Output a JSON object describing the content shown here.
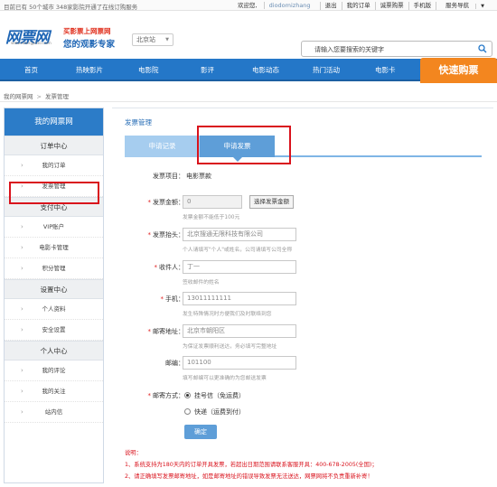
{
  "topbar": {
    "notice": "目前已有 50个城市 348家影院开通了在线订购服务",
    "greeting": "欢迎您,",
    "username": "diodomizhang",
    "logout": "退出",
    "my_orders": "我的订单",
    "tickets": "诚票购票",
    "mobile": "手机版",
    "service": "服务导航"
  },
  "header": {
    "logo": "网票网",
    "logo_url": "www.wangpiao.com",
    "slogan_line1": "买影票上网票网",
    "slogan_line2": "您的观影专家",
    "city": "北京站",
    "search_placeholder": "请输入您要搜索的关键字"
  },
  "nav": {
    "items": [
      "首页",
      "热映影片",
      "电影院",
      "影评",
      "电影动态",
      "热门活动",
      "电影卡"
    ],
    "buy_button": "快速购票"
  },
  "breadcrumb": {
    "home": "我的网票网",
    "sep": ">",
    "current": "发票管理"
  },
  "sidebar": {
    "title": "我的网票网",
    "sections": [
      {
        "title": "订单中心",
        "items": [
          "我的订单",
          "发票管理"
        ]
      },
      {
        "title": "支付中心",
        "items": [
          "VIP账户",
          "电影卡管理",
          "积分管理"
        ]
      },
      {
        "title": "设置中心",
        "items": [
          "个人资料",
          "安全设置"
        ]
      },
      {
        "title": "个人中心",
        "items": [
          "我的评论",
          "我的关注",
          "站内信"
        ]
      }
    ]
  },
  "main": {
    "title": "发票管理",
    "tab_records": "申请记录",
    "tab_apply": "申请发票",
    "invoice_item_label": "发票项目：",
    "invoice_item_value": "电影票款",
    "amount_label": "发票金额：",
    "amount_value": "0",
    "amount_button": "选择发票金额",
    "amount_hint": "发票金额不能低于100元",
    "title_label": "发票抬头：",
    "title_value": "北京搜通无限科技有限公司",
    "title_hint": "个人请填写\"个人\"或姓名，公司请填写公司全称",
    "recipient_label": "收件人：",
    "recipient_value": "丁一",
    "recipient_hint": "签收邮件的姓名",
    "phone_label": "手机：",
    "phone_value": "13011111111",
    "phone_hint": "发生特殊情况时方便我们及时联络到您",
    "address_label": "邮寄地址：",
    "address_value": "北京市朝阳区",
    "address_hint": "为保证发票顺利送达，务必填写完整地址",
    "zip_label": "邮编：",
    "zip_value": "101100",
    "zip_hint": "填写邮编可以更准确的为您邮送发票",
    "mail_label": "邮寄方式：",
    "mail_option1": "挂号信（免运费）",
    "mail_option2": "快递（运费到付）",
    "confirm": "确定",
    "notes_title": "说明：",
    "note1": "1、系统支持为180天内的订单开具发票，若超出日期范围请联系客服开具：400-678-2005(全国)；",
    "note2": "2、请正确填写发票邮寄地址，如是邮寄地址的错误导致发票无法送达，网票网将不负责重新补寄！"
  },
  "colors": {
    "nav_blue": "#2477c8",
    "buy_orange": "#f3861f",
    "highlight_red": "#d9121c",
    "tab_active": "#5e9ed8",
    "tab_inactive": "#a6cdef"
  }
}
